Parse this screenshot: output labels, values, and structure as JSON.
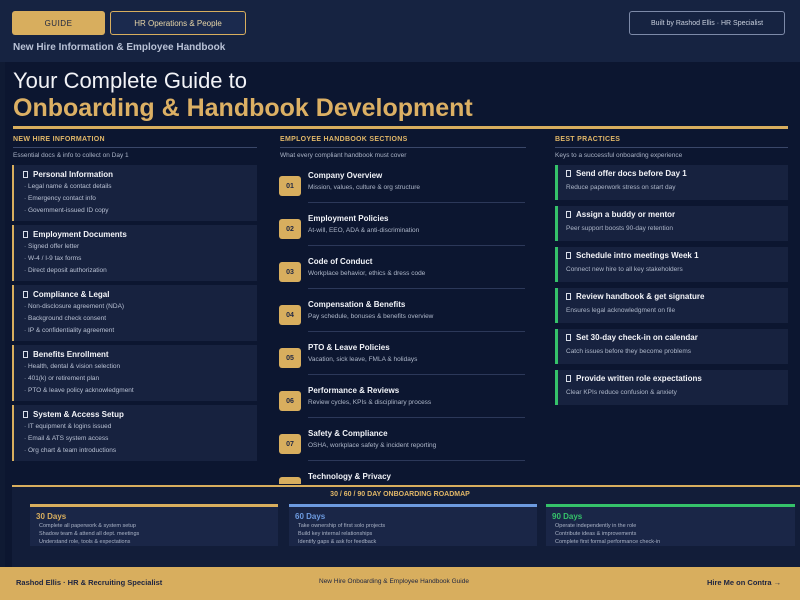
{
  "top": {
    "guide_label": "GUIDE",
    "hr_label": "HR Operations & People",
    "built_by": "Built by Rashod Ellis · HR Specialist",
    "subtitle": "New Hire Information & Employee Handbook"
  },
  "hero": {
    "line1": "Your Complete Guide to",
    "line2": "Onboarding & Handbook Development"
  },
  "col1": {
    "heading": "NEW HIRE INFORMATION",
    "sub": "Essential docs & info to collect on Day 1",
    "cards": [
      {
        "title": "Personal Information",
        "items": [
          "Legal name & contact details",
          "Emergency contact info",
          "Government-issued ID copy"
        ]
      },
      {
        "title": "Employment Documents",
        "items": [
          "Signed offer letter",
          "W-4 / I-9 tax forms",
          "Direct deposit authorization"
        ]
      },
      {
        "title": "Compliance & Legal",
        "items": [
          "Non-disclosure agreement (NDA)",
          "Background check consent",
          "IP & confidentiality agreement"
        ]
      },
      {
        "title": "Benefits Enrollment",
        "items": [
          "Health, dental & vision selection",
          "401(k) or retirement plan",
          "PTO & leave policy acknowledgment"
        ]
      },
      {
        "title": "System & Access Setup",
        "items": [
          "IT equipment & logins issued",
          "Email & ATS system access",
          "Org chart & team introductions"
        ]
      }
    ]
  },
  "col2": {
    "heading": "EMPLOYEE HANDBOOK SECTIONS",
    "sub": "What every compliant handbook must cover",
    "sections": [
      {
        "num": "01",
        "title": "Company Overview",
        "desc": "Mission, values, culture & org structure"
      },
      {
        "num": "02",
        "title": "Employment Policies",
        "desc": "At-will, EEO, ADA & anti-discrimination"
      },
      {
        "num": "03",
        "title": "Code of Conduct",
        "desc": "Workplace behavior, ethics & dress code"
      },
      {
        "num": "04",
        "title": "Compensation & Benefits",
        "desc": "Pay schedule, bonuses & benefits overview"
      },
      {
        "num": "05",
        "title": "PTO & Leave Policies",
        "desc": "Vacation, sick leave, FMLA & holidays"
      },
      {
        "num": "06",
        "title": "Performance & Reviews",
        "desc": "Review cycles, KPIs & disciplinary process"
      },
      {
        "num": "07",
        "title": "Safety & Compliance",
        "desc": "OSHA, workplace safety & incident reporting"
      },
      {
        "num": "08",
        "title": "Technology & Privacy",
        "desc": ""
      }
    ]
  },
  "col3": {
    "heading": "BEST PRACTICES",
    "sub": "Keys to a successful onboarding experience",
    "items": [
      {
        "title": "Send offer docs before Day 1",
        "desc": "Reduce paperwork stress on start day"
      },
      {
        "title": "Assign a buddy or mentor",
        "desc": "Peer support boosts 90-day retention"
      },
      {
        "title": "Schedule intro meetings Week 1",
        "desc": "Connect new hire to all key stakeholders"
      },
      {
        "title": "Review handbook & get signature",
        "desc": "Ensures legal acknowledgment on file"
      },
      {
        "title": "Set 30-day check-in on calendar",
        "desc": "Catch issues before they become problems"
      },
      {
        "title": "Provide written role expectations",
        "desc": "Clear KPIs reduce confusion & anxiety"
      }
    ]
  },
  "roadmap": {
    "title": "30 / 60 / 90 DAY ONBOARDING ROADMAP",
    "phases": [
      {
        "title": "30 Days",
        "color": "#d8ae5e",
        "lines": [
          "Complete all paperwork & system setup",
          "Shadow team & attend all dept. meetings",
          "Understand role, tools & expectations"
        ]
      },
      {
        "title": "60 Days",
        "color": "#6d9be0",
        "lines": [
          "Take ownership of first solo projects",
          "Build key internal relationships",
          "Identify gaps & ask for feedback"
        ]
      },
      {
        "title": "90 Days",
        "color": "#35c26a",
        "lines": [
          "Operate independently in the role",
          "Contribute ideas & improvements",
          "Complete first formal performance check-in"
        ]
      }
    ]
  },
  "footer": {
    "left": "Rashod Ellis  ·  HR & Recruiting Specialist",
    "middle": "New Hire Onboarding & Employee Handbook Guide",
    "right": "Hire Me on Contra  →"
  }
}
